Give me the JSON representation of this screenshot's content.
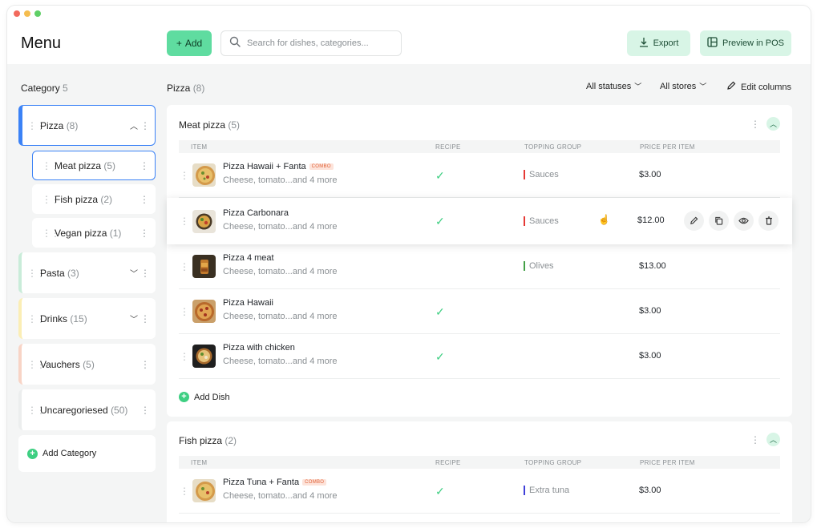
{
  "header": {
    "title": "Menu",
    "add_label": "Add",
    "search_placeholder": "Search for dishes, categories...",
    "export_label": "Export",
    "preview_label": "Preview in POS"
  },
  "window_dots": [
    "#f26a5d",
    "#f5bd4f",
    "#5fcf66"
  ],
  "sidebar": {
    "title": "Category",
    "count": "5",
    "categories": [
      {
        "name": "Pizza",
        "count": "(8)",
        "color": "#3b82f6"
      },
      {
        "name": "Pasta",
        "count": "(3)",
        "color": "#c9ecd9"
      },
      {
        "name": "Drinks",
        "count": "(15)",
        "color": "#fbeeb5"
      },
      {
        "name": "Vauchers",
        "count": "(5)",
        "color": "#f8d4c6"
      },
      {
        "name": "Uncaregoriesed",
        "count": "(50)",
        "color": "#eceeee"
      }
    ],
    "subcategories": [
      {
        "name": "Meat pizza",
        "count": "(5)"
      },
      {
        "name": "Fish pizza",
        "count": "(2)"
      },
      {
        "name": "Vegan pizza",
        "count": "(1)"
      }
    ],
    "add_category_label": "Add Category"
  },
  "main": {
    "title": "Pizza",
    "count": "(8)",
    "filters": {
      "statuses": "All statuses",
      "stores": "All stores",
      "edit_columns": "Edit columns"
    },
    "columns": [
      "ITEM",
      "RECIPE",
      "TOPPING GROUP",
      "PRICE PER ITEM"
    ],
    "sections": [
      {
        "title": "Meat pizza",
        "count": "(5)",
        "add_dish_label": "Add Dish",
        "dishes": [
          {
            "name": "Pizza Hawaii + Fanta",
            "combo": "COMBO",
            "desc": "Cheese, tomato...and 4 more",
            "recipe": true,
            "topping": "Sauces",
            "topping_color": "#e53935",
            "price": "$3.00"
          },
          {
            "name": "Pizza Carbonara",
            "desc": "Cheese, tomato...and 4 more",
            "recipe": true,
            "topping": "Sauces",
            "topping_color": "#e53935",
            "price": "$12.00"
          },
          {
            "name": "Pizza 4 meat",
            "desc": "Cheese, tomato...and 4 more",
            "recipe": false,
            "topping": "Olives",
            "topping_color": "#43a047",
            "price": "$13.00"
          },
          {
            "name": "Pizza Hawaii",
            "desc": "Cheese, tomato...and 4 more",
            "recipe": true,
            "topping": "",
            "price": "$3.00"
          },
          {
            "name": "Pizza with chicken",
            "desc": "Cheese, tomato...and 4 more",
            "recipe": true,
            "topping": "",
            "price": "$3.00"
          }
        ]
      },
      {
        "title": "Fish pizza",
        "count": "(2)",
        "dishes": [
          {
            "name": "Pizza Tuna + Fanta",
            "combo": "COMBO",
            "desc": "Cheese, tomato...and 4 more",
            "recipe": true,
            "topping": "Extra tuna",
            "topping_color": "#3f3fd8",
            "price": "$3.00"
          }
        ]
      }
    ]
  }
}
